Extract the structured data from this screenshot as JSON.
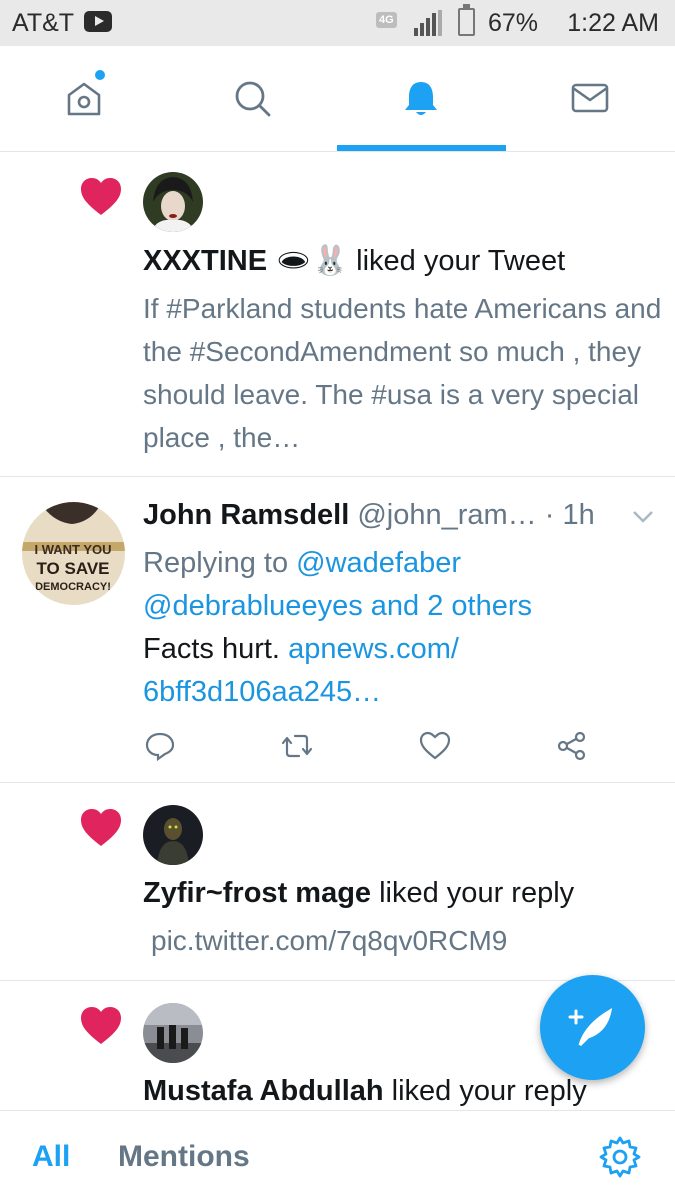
{
  "status_bar": {
    "carrier": "AT&T",
    "network": "4G LTE",
    "battery": "67%",
    "battery_level": 0.67,
    "time": "1:22 AM"
  },
  "top_nav": {
    "tabs": [
      {
        "name": "home",
        "icon": "home-icon",
        "has_dot": true
      },
      {
        "name": "search",
        "icon": "search-icon"
      },
      {
        "name": "notifications",
        "icon": "bell-icon",
        "active": true
      },
      {
        "name": "messages",
        "icon": "mail-icon"
      }
    ]
  },
  "notifications": [
    {
      "type": "like",
      "user": "XXXTINE",
      "user_emoji": "🕳🐰",
      "action": "liked your Tweet",
      "tweet_text": "If #Parkland students hate Americans and the #SecondAmendment so much , they should leave. The #usa is a very special place , the…"
    },
    {
      "type": "reply",
      "user": "John Ramsdell",
      "handle": "@john_ram…",
      "time": "· 1h",
      "replying_to_prefix": "Replying to",
      "replying_to": "@wadefaber @debrablueeyes and 2 others",
      "text": "Facts hurt.",
      "link": "apnews.com/ 6bff3d106aa245…",
      "avatar_text": "I WANT YOU TO SAVE DEMOCRACY!"
    },
    {
      "type": "like",
      "user": "Zyfir~frost mage",
      "action": "liked your reply",
      "tweet_text": "pic.twitter.com/7q8qv0RCM9"
    },
    {
      "type": "like",
      "user": "Mustafa Abdullah",
      "action": "liked your reply"
    }
  ],
  "compose": {
    "icon": "compose-feather-icon"
  },
  "bottom_bar": {
    "all": "All",
    "mentions": "Mentions",
    "settings_icon": "gear-icon"
  },
  "colors": {
    "accent": "#1da1f2",
    "like": "#e0245e",
    "secondary_text": "#657786",
    "link": "#1b95e0"
  }
}
